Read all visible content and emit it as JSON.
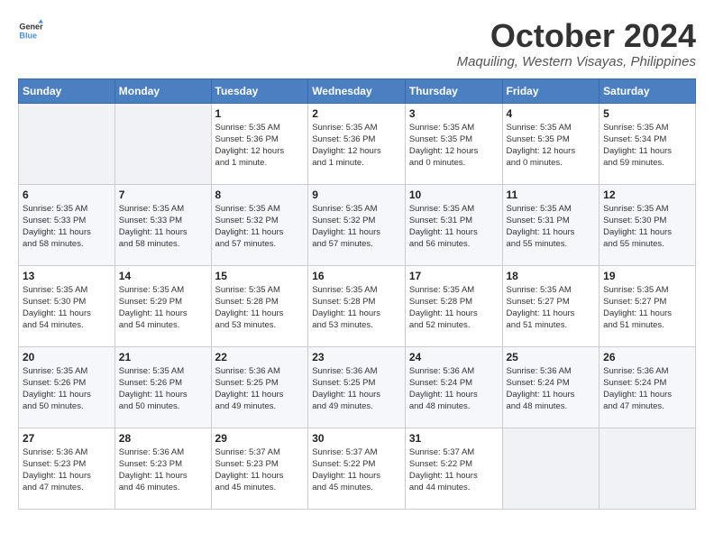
{
  "logo": {
    "text_general": "General",
    "text_blue": "Blue"
  },
  "title": "October 2024",
  "location": "Maquiling, Western Visayas, Philippines",
  "days_of_week": [
    "Sunday",
    "Monday",
    "Tuesday",
    "Wednesday",
    "Thursday",
    "Friday",
    "Saturday"
  ],
  "weeks": [
    [
      {
        "day": "",
        "info": ""
      },
      {
        "day": "",
        "info": ""
      },
      {
        "day": "1",
        "info": "Sunrise: 5:35 AM\nSunset: 5:36 PM\nDaylight: 12 hours\nand 1 minute."
      },
      {
        "day": "2",
        "info": "Sunrise: 5:35 AM\nSunset: 5:36 PM\nDaylight: 12 hours\nand 1 minute."
      },
      {
        "day": "3",
        "info": "Sunrise: 5:35 AM\nSunset: 5:35 PM\nDaylight: 12 hours\nand 0 minutes."
      },
      {
        "day": "4",
        "info": "Sunrise: 5:35 AM\nSunset: 5:35 PM\nDaylight: 12 hours\nand 0 minutes."
      },
      {
        "day": "5",
        "info": "Sunrise: 5:35 AM\nSunset: 5:34 PM\nDaylight: 11 hours\nand 59 minutes."
      }
    ],
    [
      {
        "day": "6",
        "info": "Sunrise: 5:35 AM\nSunset: 5:33 PM\nDaylight: 11 hours\nand 58 minutes."
      },
      {
        "day": "7",
        "info": "Sunrise: 5:35 AM\nSunset: 5:33 PM\nDaylight: 11 hours\nand 58 minutes."
      },
      {
        "day": "8",
        "info": "Sunrise: 5:35 AM\nSunset: 5:32 PM\nDaylight: 11 hours\nand 57 minutes."
      },
      {
        "day": "9",
        "info": "Sunrise: 5:35 AM\nSunset: 5:32 PM\nDaylight: 11 hours\nand 57 minutes."
      },
      {
        "day": "10",
        "info": "Sunrise: 5:35 AM\nSunset: 5:31 PM\nDaylight: 11 hours\nand 56 minutes."
      },
      {
        "day": "11",
        "info": "Sunrise: 5:35 AM\nSunset: 5:31 PM\nDaylight: 11 hours\nand 55 minutes."
      },
      {
        "day": "12",
        "info": "Sunrise: 5:35 AM\nSunset: 5:30 PM\nDaylight: 11 hours\nand 55 minutes."
      }
    ],
    [
      {
        "day": "13",
        "info": "Sunrise: 5:35 AM\nSunset: 5:30 PM\nDaylight: 11 hours\nand 54 minutes."
      },
      {
        "day": "14",
        "info": "Sunrise: 5:35 AM\nSunset: 5:29 PM\nDaylight: 11 hours\nand 54 minutes."
      },
      {
        "day": "15",
        "info": "Sunrise: 5:35 AM\nSunset: 5:28 PM\nDaylight: 11 hours\nand 53 minutes."
      },
      {
        "day": "16",
        "info": "Sunrise: 5:35 AM\nSunset: 5:28 PM\nDaylight: 11 hours\nand 53 minutes."
      },
      {
        "day": "17",
        "info": "Sunrise: 5:35 AM\nSunset: 5:28 PM\nDaylight: 11 hours\nand 52 minutes."
      },
      {
        "day": "18",
        "info": "Sunrise: 5:35 AM\nSunset: 5:27 PM\nDaylight: 11 hours\nand 51 minutes."
      },
      {
        "day": "19",
        "info": "Sunrise: 5:35 AM\nSunset: 5:27 PM\nDaylight: 11 hours\nand 51 minutes."
      }
    ],
    [
      {
        "day": "20",
        "info": "Sunrise: 5:35 AM\nSunset: 5:26 PM\nDaylight: 11 hours\nand 50 minutes."
      },
      {
        "day": "21",
        "info": "Sunrise: 5:35 AM\nSunset: 5:26 PM\nDaylight: 11 hours\nand 50 minutes."
      },
      {
        "day": "22",
        "info": "Sunrise: 5:36 AM\nSunset: 5:25 PM\nDaylight: 11 hours\nand 49 minutes."
      },
      {
        "day": "23",
        "info": "Sunrise: 5:36 AM\nSunset: 5:25 PM\nDaylight: 11 hours\nand 49 minutes."
      },
      {
        "day": "24",
        "info": "Sunrise: 5:36 AM\nSunset: 5:24 PM\nDaylight: 11 hours\nand 48 minutes."
      },
      {
        "day": "25",
        "info": "Sunrise: 5:36 AM\nSunset: 5:24 PM\nDaylight: 11 hours\nand 48 minutes."
      },
      {
        "day": "26",
        "info": "Sunrise: 5:36 AM\nSunset: 5:24 PM\nDaylight: 11 hours\nand 47 minutes."
      }
    ],
    [
      {
        "day": "27",
        "info": "Sunrise: 5:36 AM\nSunset: 5:23 PM\nDaylight: 11 hours\nand 47 minutes."
      },
      {
        "day": "28",
        "info": "Sunrise: 5:36 AM\nSunset: 5:23 PM\nDaylight: 11 hours\nand 46 minutes."
      },
      {
        "day": "29",
        "info": "Sunrise: 5:37 AM\nSunset: 5:23 PM\nDaylight: 11 hours\nand 45 minutes."
      },
      {
        "day": "30",
        "info": "Sunrise: 5:37 AM\nSunset: 5:22 PM\nDaylight: 11 hours\nand 45 minutes."
      },
      {
        "day": "31",
        "info": "Sunrise: 5:37 AM\nSunset: 5:22 PM\nDaylight: 11 hours\nand 44 minutes."
      },
      {
        "day": "",
        "info": ""
      },
      {
        "day": "",
        "info": ""
      }
    ]
  ]
}
